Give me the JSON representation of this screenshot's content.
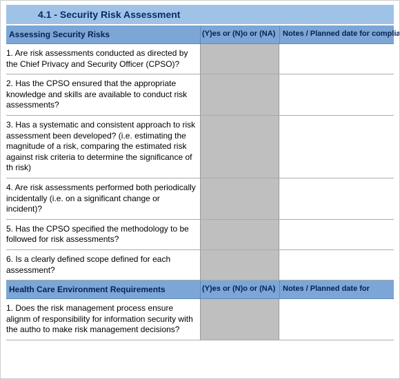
{
  "title": "4.1 - Security Risk Assessment",
  "section1": {
    "header": {
      "question_col": "Assessing Security Risks",
      "yn_col": "(Y)es or (N)o or (NA)",
      "notes_col": "Notes  / Planned date for compliance"
    },
    "rows": [
      {
        "q": "1. Are risk assessments conducted as directed by the Chief Privacy and Security Officer (CPSO)?"
      },
      {
        "q": "2. Has the CPSO ensured that the appropriate knowledge and skills are available to conduct risk assessments?"
      },
      {
        "q": "3. Has a systematic and consistent approach to risk assessment been developed? (i.e. estimating the magnitude of a risk, comparing the estimated risk against risk criteria to determine the significance of th risk)"
      },
      {
        "q": "4. Are risk assessments performed both periodically incidentally (i.e. on a significant change or incident)?"
      },
      {
        "q": "5. Has the CPSO specified the methodology to be followed for risk assessments?"
      },
      {
        "q": "6. Is a clearly defined scope defined for each assessment?"
      }
    ]
  },
  "section2": {
    "header": {
      "question_col": "Health Care Environment Requirements",
      "yn_col": "(Y)es or (N)o or (NA)",
      "notes_col": "Notes  / Planned date for"
    },
    "rows": [
      {
        "q": "1. Does the risk management process ensure alignm of responsibility for information security with the autho to make risk management decisions?"
      }
    ]
  }
}
